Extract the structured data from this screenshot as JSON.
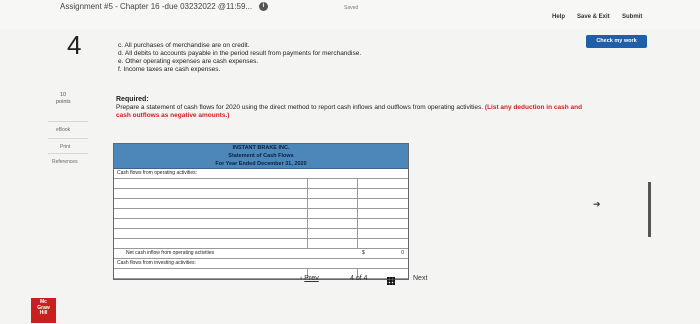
{
  "header": {
    "title": "Assignment #5 - Chapter 16 -due 03232022 @11:59...",
    "info": "i",
    "saved": "Saved",
    "help": "Help",
    "save_exit": "Save & Exit",
    "submit": "Submit",
    "check_work": "Check my work"
  },
  "question": {
    "number": "4",
    "points_value": "10",
    "points_label": "points"
  },
  "sidebar": {
    "ebook": "eBook",
    "print": "Print",
    "references": "References"
  },
  "statements": [
    "c. All purchases of merchandise are on credit.",
    "d. All debits to accounts payable in the period result from payments for merchandise.",
    "e. Other operating expenses are cash expenses.",
    "f. Income taxes are cash expenses."
  ],
  "required": {
    "label": "Required:",
    "text": "Prepare a statement of cash flows for 2020 using the direct method to report cash inflows and outflows from operating activities.",
    "note": "(List any deduction in cash and cash outflows as negative amounts.)"
  },
  "table": {
    "company": "INSTANT BRAKE INC.",
    "statement": "Statement of Cash Flows",
    "period": "For Year Ended December 31, 2020",
    "section_operating": "Cash flows from operating activities:",
    "net_operating": "Net cash inflow from operating activities",
    "dollar": "$",
    "net_operating_value": "0",
    "section_investing": "Cash flows from investing activities:"
  },
  "nav": {
    "prev": "Prev",
    "page": "4",
    "of": "of",
    "total": "4",
    "next": "Next"
  },
  "logo": {
    "line1": "Mc",
    "line2": "Graw",
    "line3": "Hill"
  }
}
